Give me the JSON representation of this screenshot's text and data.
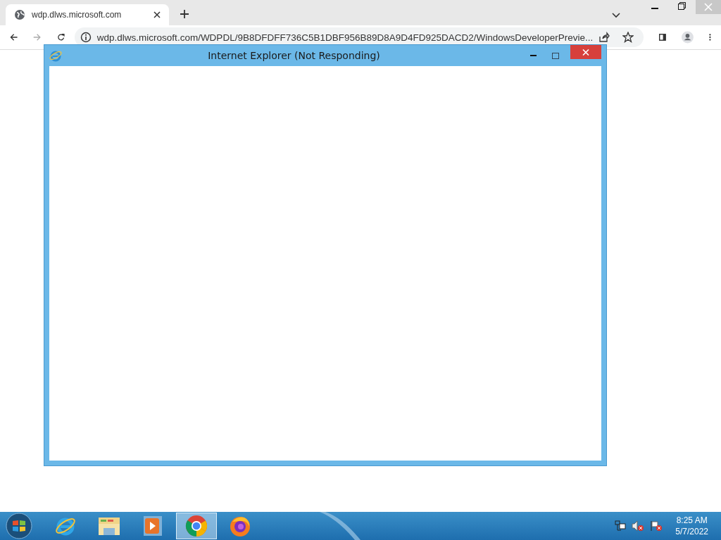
{
  "browser": {
    "tab": {
      "title": "wdp.dlws.microsoft.com",
      "selected": true
    },
    "address": "wdp.dlws.microsoft.com/WDPDL/9B8DFDFF736C5B1DBF956B89D8A9D4FD925DACD2/WindowsDeveloperPrevie..."
  },
  "window": {
    "title": "Internet Explorer (Not Responding)"
  },
  "taskbar": {
    "items": [
      {
        "kind": "ie",
        "selected": false
      },
      {
        "kind": "folder",
        "selected": false
      },
      {
        "kind": "media",
        "selected": false
      },
      {
        "kind": "chrome",
        "selected": true
      },
      {
        "kind": "firefox",
        "selected": false
      }
    ],
    "clock": {
      "time": "8:25 AM",
      "date": "5/7/2022"
    }
  }
}
